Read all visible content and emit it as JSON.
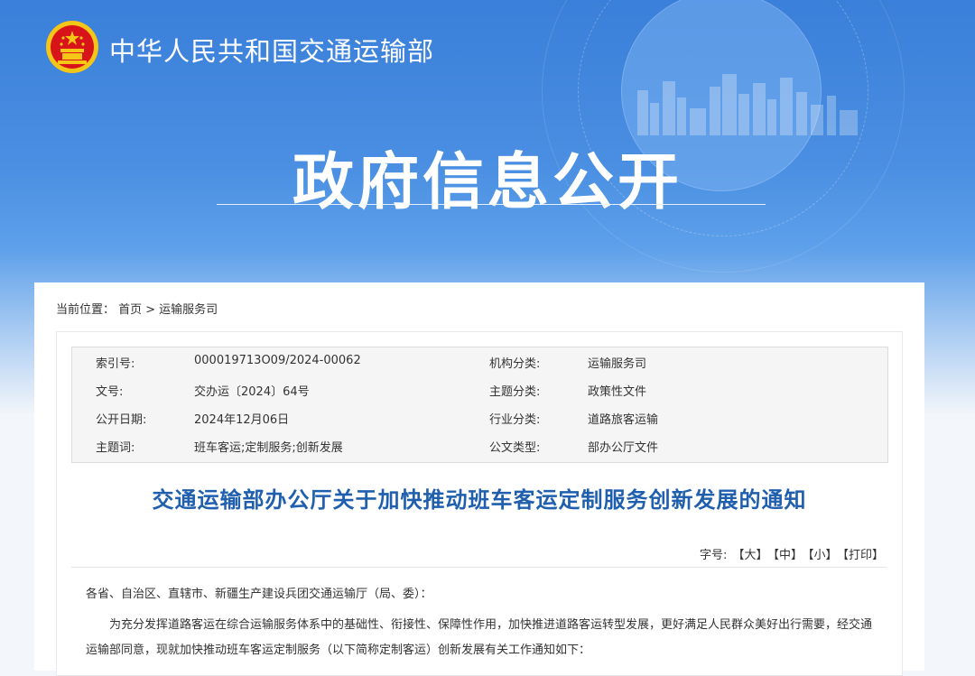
{
  "header": {
    "ministry_name": "中华人民共和国交通运输部",
    "section_title": "政府信息公开",
    "emblem_icon": "national-emblem-icon"
  },
  "breadcrumb": {
    "label": "当前位置：",
    "items": [
      "首页",
      "运输服务司"
    ],
    "separator": ">"
  },
  "meta": {
    "rows": [
      {
        "k1": "索引号:",
        "v1": "000019713O09/2024-00062",
        "k2": "机构分类:",
        "v2": "运输服务司"
      },
      {
        "k1": "文号:",
        "v1": "交办运〔2024〕64号",
        "k2": "主题分类:",
        "v2": "政策性文件"
      },
      {
        "k1": "公开日期:",
        "v1": "2024年12月06日",
        "k2": "行业分类:",
        "v2": "道路旅客运输"
      },
      {
        "k1": "主题词:",
        "v1": "班车客运;定制服务;创新发展",
        "k2": "公文类型:",
        "v2": "部办公厅文件"
      }
    ]
  },
  "document": {
    "title": "交通运输部办公厅关于加快推动班车客运定制服务创新发展的通知",
    "font_size_label": "字号:",
    "font_large": "【大】",
    "font_medium": "【中】",
    "font_small": "【小】",
    "print": "【打印】",
    "salutation": "各省、自治区、直辖市、新疆生产建设兵团交通运输厅（局、委）：",
    "paragraph1": "为充分发挥道路客运在综合运输服务体系中的基础性、衔接性、保障性作用，加快推进道路客运转型发展，更好满足人民群众美好出行需要，经交通运输部同意，现就加快推动班车客运定制服务（以下简称定制客运）创新发展有关工作通知如下："
  },
  "colors": {
    "banner": "#3a7fd9",
    "title_blue": "#1f5fae",
    "emblem_red": "#d7141a",
    "emblem_gold": "#f5c518"
  }
}
